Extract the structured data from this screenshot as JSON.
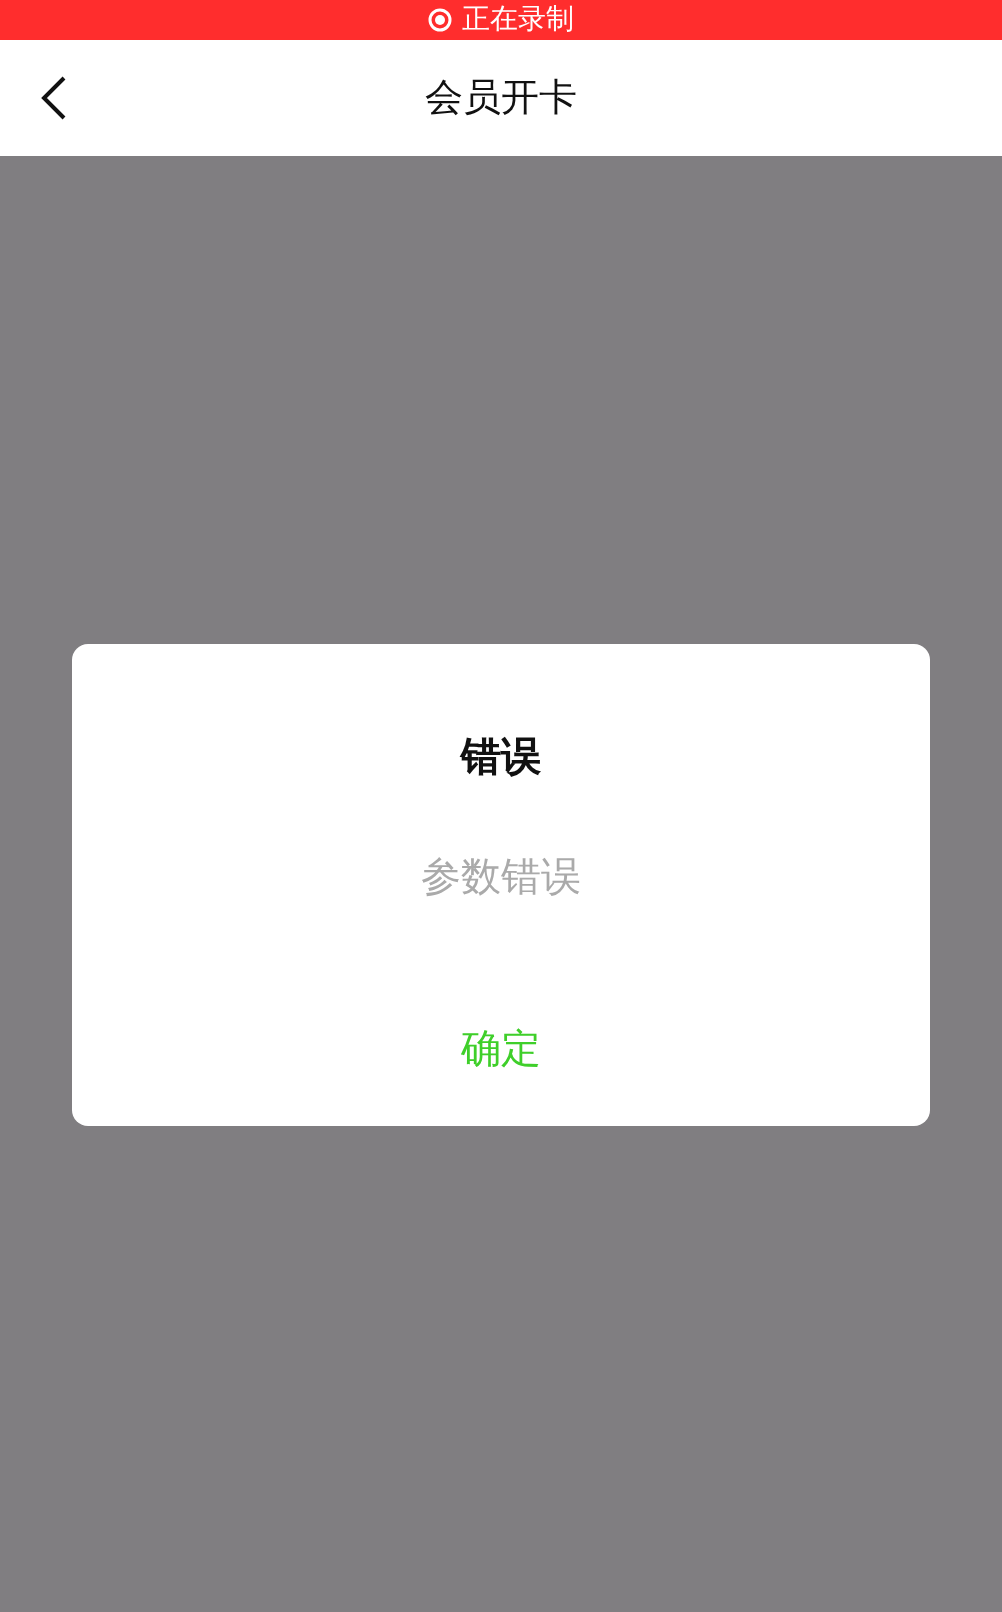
{
  "recording_bar": {
    "label": "正在录制"
  },
  "nav_bar": {
    "title": "会员开卡"
  },
  "dialog": {
    "title": "错误",
    "message": "参数错误",
    "button": "确定"
  }
}
